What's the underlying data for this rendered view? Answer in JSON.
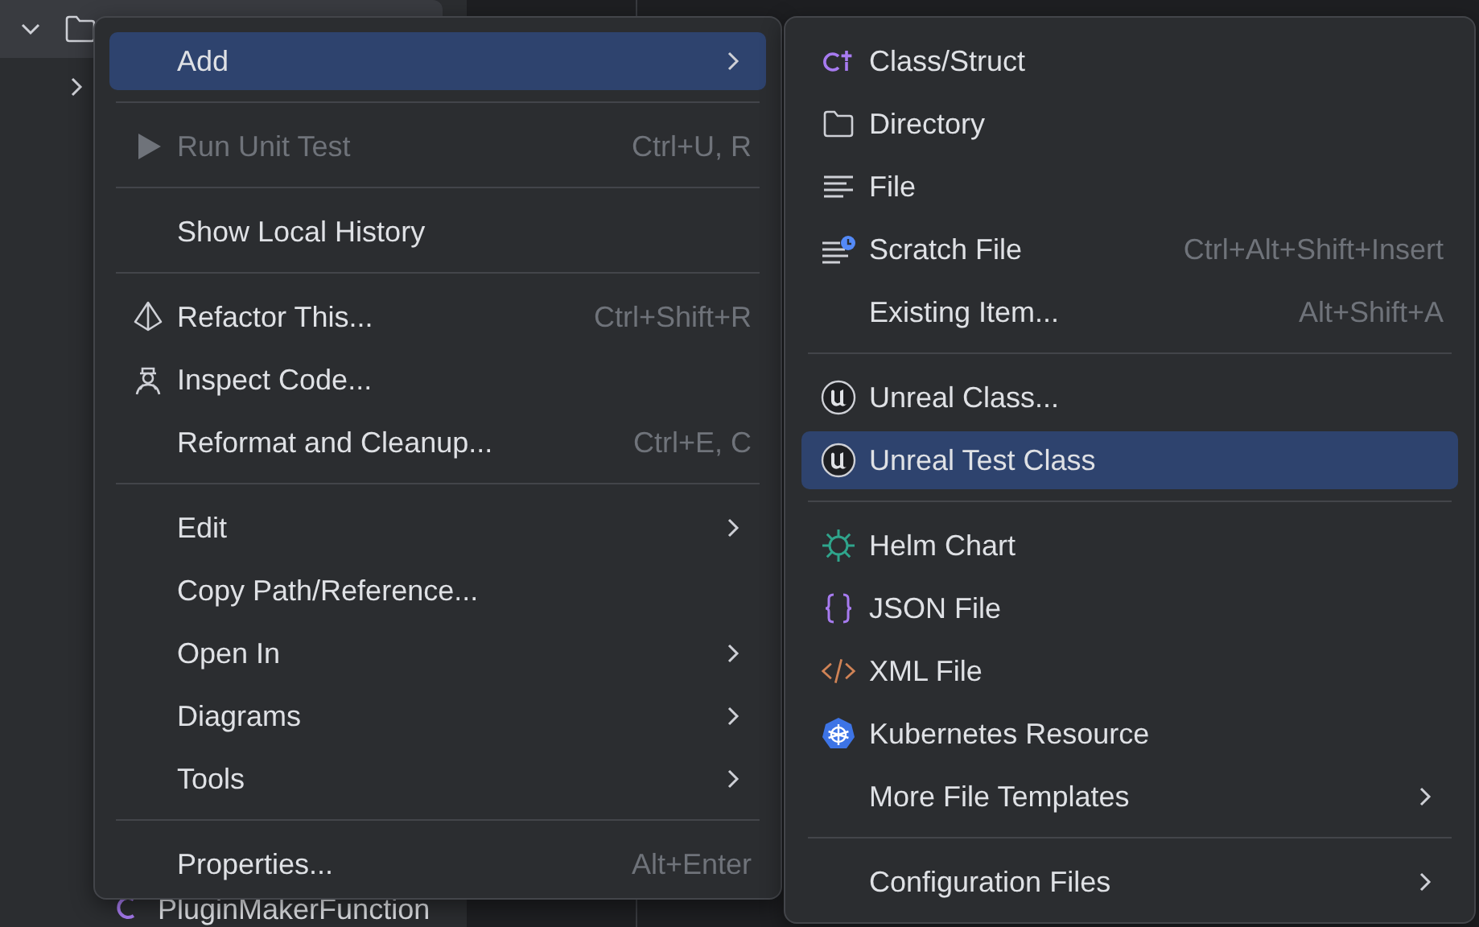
{
  "project_tree": {
    "items": [
      {
        "kind": "folder",
        "expanded": true,
        "selected": true
      },
      {
        "kind": "node",
        "expanded": false,
        "selected": false
      }
    ],
    "partial_file": {
      "label": "PluginMakerFunction"
    }
  },
  "context_menu": {
    "items": [
      {
        "kind": "plain",
        "label": "Add",
        "submenu": true,
        "selected": true,
        "disabled": false
      },
      {
        "kind": "separator"
      },
      {
        "kind": "play",
        "label": "Run Unit Test",
        "shortcut": "Ctrl+U, R",
        "submenu": false,
        "selected": false,
        "disabled": true
      },
      {
        "kind": "separator"
      },
      {
        "kind": "plain",
        "label": "Show Local History",
        "submenu": false,
        "selected": false,
        "disabled": false
      },
      {
        "kind": "separator"
      },
      {
        "kind": "refactor",
        "label": "Refactor This...",
        "shortcut": "Ctrl+Shift+R",
        "submenu": false,
        "selected": false,
        "disabled": false
      },
      {
        "kind": "inspect",
        "label": "Inspect Code...",
        "submenu": false,
        "selected": false,
        "disabled": false
      },
      {
        "kind": "plain",
        "label": "Reformat and Cleanup...",
        "shortcut": "Ctrl+E, C",
        "submenu": false,
        "selected": false,
        "disabled": false
      },
      {
        "kind": "separator"
      },
      {
        "kind": "plain",
        "label": "Edit",
        "submenu": true,
        "selected": false,
        "disabled": false
      },
      {
        "kind": "plain",
        "label": "Copy Path/Reference...",
        "submenu": false,
        "selected": false,
        "disabled": false
      },
      {
        "kind": "plain",
        "label": "Open In",
        "submenu": true,
        "selected": false,
        "disabled": false
      },
      {
        "kind": "plain",
        "label": "Diagrams",
        "submenu": true,
        "selected": false,
        "disabled": false
      },
      {
        "kind": "plain",
        "label": "Tools",
        "submenu": true,
        "selected": false,
        "disabled": false
      },
      {
        "kind": "separator"
      },
      {
        "kind": "plain",
        "label": "Properties...",
        "shortcut": "Alt+Enter",
        "submenu": false,
        "selected": false,
        "disabled": false
      }
    ]
  },
  "add_submenu": {
    "items": [
      {
        "kind": "class",
        "label": "Class/Struct",
        "submenu": false,
        "selected": false,
        "disabled": false
      },
      {
        "kind": "folder",
        "label": "Directory",
        "submenu": false,
        "selected": false,
        "disabled": false
      },
      {
        "kind": "file",
        "label": "File",
        "submenu": false,
        "selected": false,
        "disabled": false
      },
      {
        "kind": "scratch",
        "label": "Scratch File",
        "shortcut": "Ctrl+Alt+Shift+Insert",
        "submenu": false,
        "selected": false,
        "disabled": false
      },
      {
        "kind": "plain",
        "label": "Existing Item...",
        "shortcut": "Alt+Shift+A",
        "submenu": false,
        "selected": false,
        "disabled": false
      },
      {
        "kind": "separator"
      },
      {
        "kind": "unreal",
        "label": "Unreal Class...",
        "submenu": false,
        "selected": false,
        "disabled": false
      },
      {
        "kind": "unreal",
        "label": "Unreal Test Class",
        "submenu": false,
        "selected": true,
        "disabled": false
      },
      {
        "kind": "separator"
      },
      {
        "kind": "helm",
        "label": "Helm Chart",
        "submenu": false,
        "selected": false,
        "disabled": false
      },
      {
        "kind": "json",
        "label": "JSON File",
        "submenu": false,
        "selected": false,
        "disabled": false
      },
      {
        "kind": "xml",
        "label": "XML File",
        "submenu": false,
        "selected": false,
        "disabled": false
      },
      {
        "kind": "kubernetes",
        "label": "Kubernetes Resource",
        "submenu": false,
        "selected": false,
        "disabled": false
      },
      {
        "kind": "plain",
        "label": "More File Templates",
        "submenu": true,
        "selected": false,
        "disabled": false
      },
      {
        "kind": "separator"
      },
      {
        "kind": "plain",
        "label": "Configuration Files",
        "submenu": true,
        "selected": false,
        "disabled": false
      }
    ]
  }
}
